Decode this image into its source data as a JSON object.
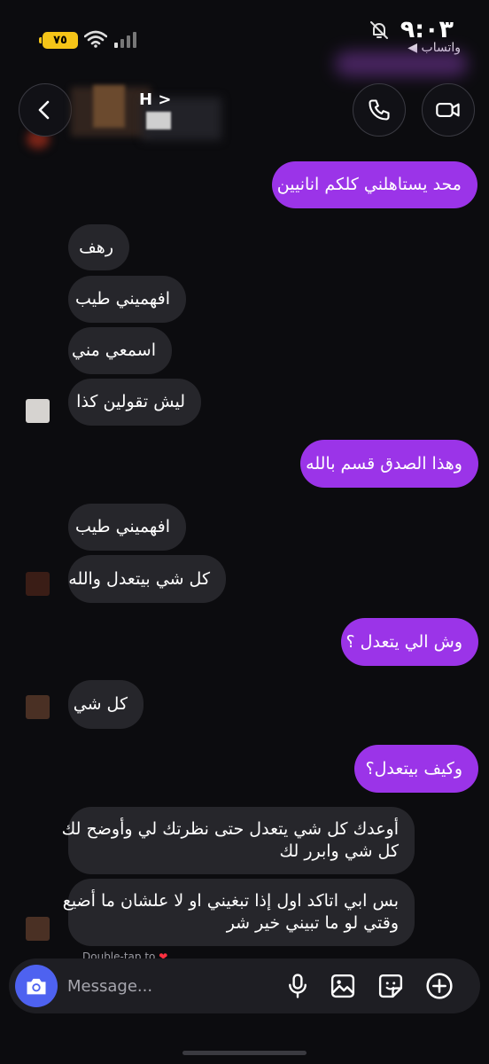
{
  "status_bar": {
    "time": "٩:٠٣",
    "back_app_label": "◀ واتساب",
    "battery": "٧٥"
  },
  "header": {
    "contact_name": "H >"
  },
  "messages": [
    {
      "dir": "out",
      "text": "محد يستاهلني كلكم انانيين"
    },
    {
      "dir": "in",
      "text": "رهف"
    },
    {
      "dir": "in",
      "text": "افهميني طيب"
    },
    {
      "dir": "in",
      "text": "اسمعي مني"
    },
    {
      "dir": "in",
      "text": "ليش تقولين كذا"
    },
    {
      "dir": "out",
      "text": "وهذا الصدق قسم بالله"
    },
    {
      "dir": "in",
      "text": "افهميني طيب"
    },
    {
      "dir": "in",
      "text": "كل شي بيتعدل والله"
    },
    {
      "dir": "out",
      "text": "وش الي يتعدل ؟"
    },
    {
      "dir": "in",
      "text": "كل شي"
    },
    {
      "dir": "out",
      "text": "وكيف بيتعدل؟"
    },
    {
      "dir": "in",
      "lines": [
        "أوعدك كل شي يتعدل حتى نظرتك لي وأوضح لك",
        "كل شي وابرر لك"
      ]
    },
    {
      "dir": "in",
      "lines": [
        "بس ابي اتاكد اول إذا تبغيني او لا علشان ما أضيع",
        "وقتي لو ما تبيني خير شر"
      ]
    }
  ],
  "footer": {
    "double_tap_hint": "Double-tap to",
    "heart": "❤",
    "composer_placeholder": "Message..."
  },
  "colors": {
    "outgoing_bubble": "#9b34e8",
    "incoming_bubble": "#26262b",
    "camera_button": "#4e62f0",
    "background": "#0c0c0f"
  },
  "icons": {
    "back": "chevron-left-icon",
    "call": "phone-icon",
    "video": "video-camera-icon",
    "camera": "camera-icon",
    "mic": "microphone-icon",
    "gallery": "image-icon",
    "sticker": "sticker-icon",
    "add": "plus-circle-icon"
  }
}
